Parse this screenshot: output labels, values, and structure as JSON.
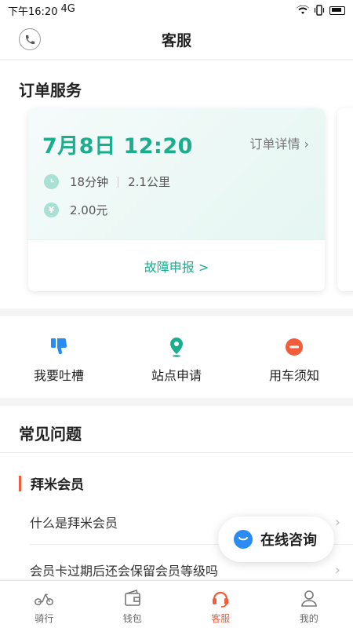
{
  "status_bar": {
    "time": "下午16:20",
    "network": "4G"
  },
  "header": {
    "title": "客服",
    "phone_icon": "phone-icon"
  },
  "order_service": {
    "title": "订单服务",
    "card": {
      "date_time": "7月8日 12:20",
      "detail_link": "订单详情 ›",
      "duration": "18分钟",
      "distance": "2.1公里",
      "price": "2.00元",
      "clock_icon": "clock-icon",
      "yen_icon": "yen-icon",
      "yen_glyph": "¥",
      "report_link": "故障申报 >"
    }
  },
  "quick_actions": [
    {
      "label": "我要吐槽",
      "icon": "thumbs-down-icon",
      "color": "#2a8bf2"
    },
    {
      "label": "站点申请",
      "icon": "location-pin-icon",
      "color": "#1aae8c"
    },
    {
      "label": "用车须知",
      "icon": "minus-circle-icon",
      "color": "#f25c3b"
    }
  ],
  "faq": {
    "title": "常见问题",
    "category": "拜米会员",
    "items": [
      {
        "question": "什么是拜米会员",
        "chevron": "›"
      },
      {
        "question": "会员卡过期后还会保留会员等级吗",
        "chevron": "›"
      }
    ]
  },
  "consult_button": {
    "label": "在线咨询",
    "icon": "chat-bubble-icon"
  },
  "tabbar": [
    {
      "label": "骑行",
      "icon": "scooter-icon",
      "active": false
    },
    {
      "label": "钱包",
      "icon": "wallet-icon",
      "active": false
    },
    {
      "label": "客服",
      "icon": "headset-icon",
      "active": true
    },
    {
      "label": "我的",
      "icon": "user-icon",
      "active": false
    }
  ],
  "colors": {
    "accent_green": "#1aae8c",
    "accent_red": "#f25c3b",
    "accent_blue": "#2a8bf2"
  }
}
